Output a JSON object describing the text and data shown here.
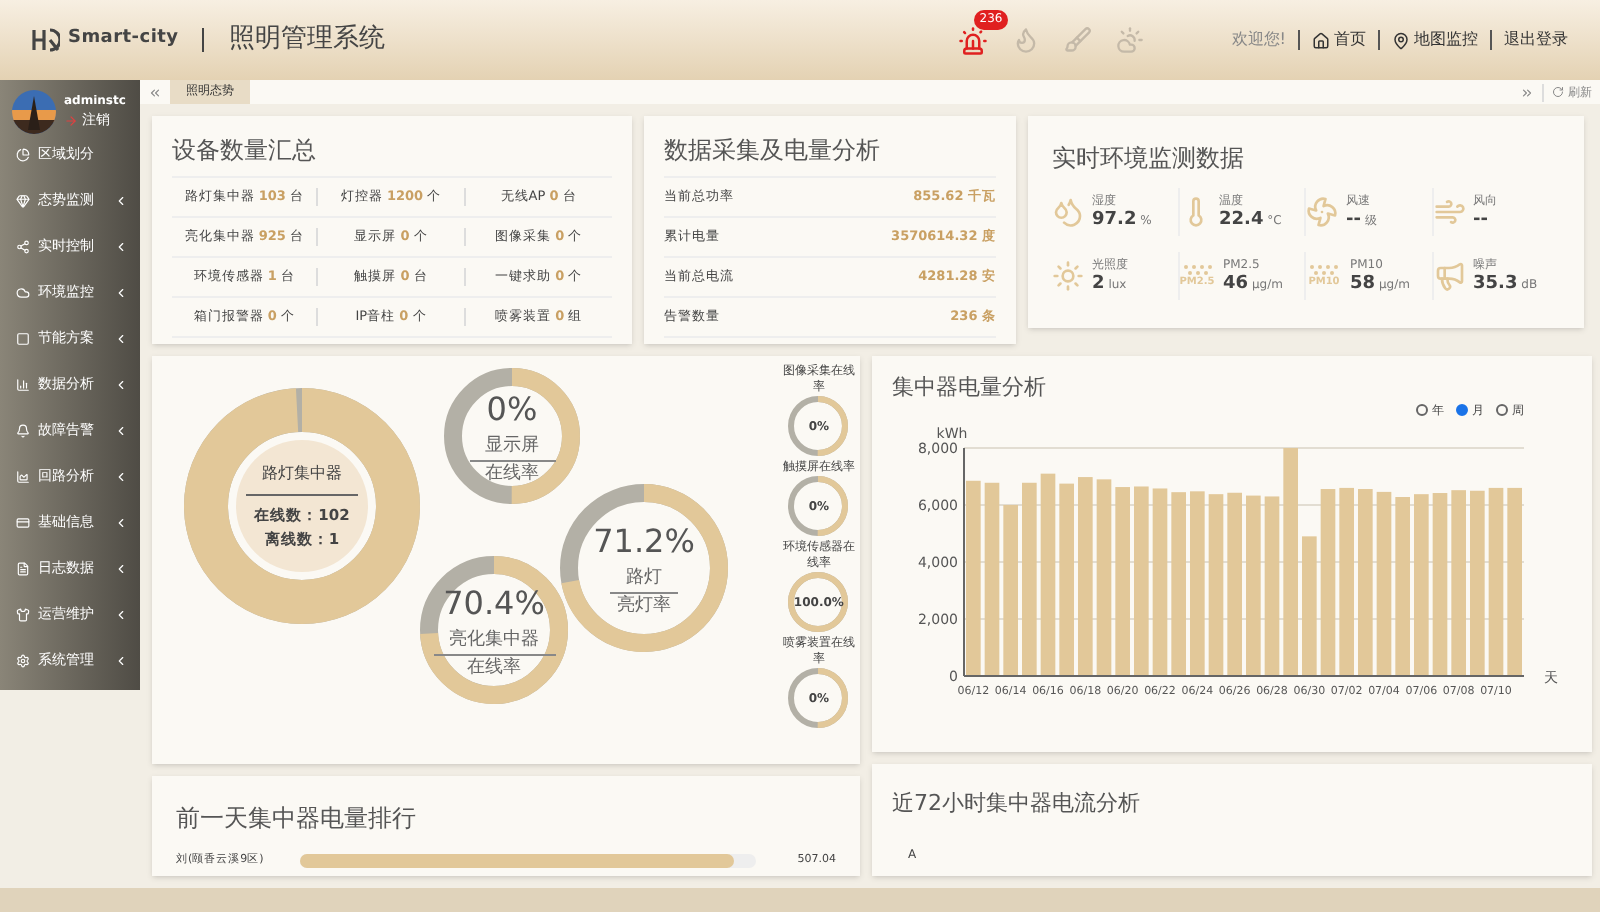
{
  "header": {
    "logo": "Smart-city",
    "title": "照明管理系统",
    "alarm_count": "236",
    "welcome": "欢迎您!",
    "links": [
      {
        "label": "首页",
        "kind": "home"
      },
      {
        "label": "地图监控",
        "kind": "map"
      },
      {
        "label": "退出登录",
        "kind": "logout"
      }
    ]
  },
  "user": {
    "name": "adminstc",
    "logout": "注销"
  },
  "sidebar": {
    "items": [
      {
        "label": "区域划分",
        "kind": "pie",
        "expandable": false
      },
      {
        "label": "态势监测",
        "kind": "gem",
        "expandable": true
      },
      {
        "label": "实时控制",
        "kind": "share",
        "expandable": true
      },
      {
        "label": "环境监控",
        "kind": "cloud",
        "expandable": true
      },
      {
        "label": "节能方案",
        "kind": "square",
        "expandable": true
      },
      {
        "label": "数据分析",
        "kind": "chart",
        "expandable": true
      },
      {
        "label": "故障告警",
        "kind": "bell",
        "expandable": true
      },
      {
        "label": "回路分析",
        "kind": "area",
        "expandable": true
      },
      {
        "label": "基础信息",
        "kind": "card",
        "expandable": true
      },
      {
        "label": "日志数据",
        "kind": "log",
        "expandable": true
      },
      {
        "label": "运营维护",
        "kind": "shirt",
        "expandable": true
      },
      {
        "label": "系统管理",
        "kind": "gear",
        "expandable": true
      }
    ]
  },
  "tabs": {
    "items": [
      {
        "label": "照明态势",
        "selected": true
      }
    ],
    "refresh": "刷新"
  },
  "device_summary": {
    "title": "设备数量汇总",
    "rows": [
      [
        {
          "label": "路灯集中器",
          "value": "103",
          "unit": "台"
        },
        {
          "label": "灯控器",
          "value": "1200",
          "unit": "个"
        },
        {
          "label": "无线AP",
          "value": "0",
          "unit": "台"
        }
      ],
      [
        {
          "label": "亮化集中器",
          "value": "925",
          "unit": "台"
        },
        {
          "label": "显示屏",
          "value": "0",
          "unit": "个"
        },
        {
          "label": "图像采集",
          "value": "0",
          "unit": "个"
        }
      ],
      [
        {
          "label": "环境传感器",
          "value": "1",
          "unit": "台"
        },
        {
          "label": "触摸屏",
          "value": "0",
          "unit": "台"
        },
        {
          "label": "一键求助",
          "value": "0",
          "unit": "个"
        }
      ],
      [
        {
          "label": "箱门报警器",
          "value": "0",
          "unit": "个"
        },
        {
          "label": "IP音柱",
          "value": "0",
          "unit": "个"
        },
        {
          "label": "喷雾装置",
          "value": "0",
          "unit": "组"
        }
      ]
    ]
  },
  "power_analysis": {
    "title": "数据采集及电量分析",
    "rows": [
      {
        "label": "当前总功率",
        "value": "855.62",
        "unit": "千瓦"
      },
      {
        "label": "累计电量",
        "value": "3570614.32",
        "unit": "度"
      },
      {
        "label": "当前总电流",
        "value": "4281.28",
        "unit": "安"
      },
      {
        "label": "告警数量",
        "value": "236",
        "unit": "条"
      }
    ]
  },
  "environment": {
    "title": "实时环境监测数据",
    "items": [
      {
        "kind": "humidity",
        "label": "湿度",
        "value": "97.2",
        "unit": "%"
      },
      {
        "kind": "temperature",
        "label": "温度",
        "value": "22.4",
        "unit": "°C"
      },
      {
        "kind": "wind_speed",
        "label": "风速",
        "value": "--",
        "unit": "级"
      },
      {
        "kind": "wind_dir",
        "label": "风向",
        "value": "--"
      },
      {
        "kind": "light",
        "label": "光照度",
        "value": "2",
        "unit": "lux"
      },
      {
        "kind": "pm",
        "label": "PM2.5",
        "badge": "PM2.5",
        "value": "46",
        "unit": "μg/m"
      },
      {
        "kind": "pm",
        "label": "PM10",
        "badge": "PM10",
        "value": "58",
        "unit": "μg/m"
      },
      {
        "kind": "noise",
        "label": "噪声",
        "value": "35.3",
        "unit": "dB"
      }
    ]
  },
  "concentrator": {
    "title": "路灯集中器",
    "online": "在线数：102",
    "offline": "离线数：1",
    "level": 0.99
  },
  "gauges": [
    {
      "value": "0%",
      "label": "显示屏",
      "sub": "在线率",
      "level": 0.5
    },
    {
      "value": "71.2%",
      "label": "路灯",
      "sub": "亮灯率",
      "level": 0.72
    },
    {
      "value": "70.4%",
      "label": "亮化集中器",
      "sub": "在线率",
      "level": 0.74
    }
  ],
  "mini_gauges": [
    {
      "label": "图像采集在线率",
      "value": "0%",
      "level": 0.5
    },
    {
      "label": "触摸屏在线率",
      "value": "0%",
      "level": 0.5
    },
    {
      "label": "环境传感器在线率",
      "value": "100.0%",
      "level": 1
    },
    {
      "label": "喷雾装置在线率",
      "value": "0%",
      "level": 0.5
    }
  ],
  "energy_chart": {
    "title": "集中器电量分析",
    "periods": [
      {
        "label": "年",
        "selected": false
      },
      {
        "label": "月",
        "selected": true
      },
      {
        "label": "周",
        "selected": false
      }
    ],
    "chart_data": {
      "type": "bar",
      "ylabel": "kWh",
      "xlabel": "天",
      "ylim": [
        0,
        8000
      ],
      "yticks": [
        {
          "value": 0,
          "label": "0"
        },
        {
          "value": 2000,
          "label": "2,000"
        },
        {
          "value": 4000,
          "label": "4,000"
        },
        {
          "value": 6000,
          "label": "6,000"
        },
        {
          "value": 8000,
          "label": "8,000"
        }
      ],
      "grid": true,
      "categories": [
        "06/12",
        null,
        "06/14",
        null,
        "06/16",
        null,
        "06/18",
        null,
        "06/20",
        null,
        "06/22",
        null,
        "06/24",
        null,
        "06/26",
        null,
        "06/28",
        null,
        "06/30",
        null,
        "07/02",
        null,
        "07/04",
        null,
        "07/06",
        null,
        "07/08",
        null,
        "07/10",
        null
      ],
      "series": [
        {
          "color": "#e2c899",
          "values": [
            6850,
            6780,
            6000,
            6780,
            7100,
            6750,
            6980,
            6900,
            6630,
            6650,
            6580,
            6450,
            6480,
            6380,
            6430,
            6330,
            6300,
            8000,
            4900,
            6560,
            6600,
            6560,
            6460,
            6280,
            6380,
            6420,
            6520,
            6500,
            6600,
            6600
          ]
        }
      ]
    }
  },
  "ranking": {
    "title": "前一天集中器电量排行",
    "rows": [
      {
        "label": "刘(颐香云溪9区)",
        "value": "507.04",
        "level": 0.95
      }
    ]
  },
  "current_chart": {
    "title": "近72小时集中器电流分析",
    "ylabel": "A"
  }
}
